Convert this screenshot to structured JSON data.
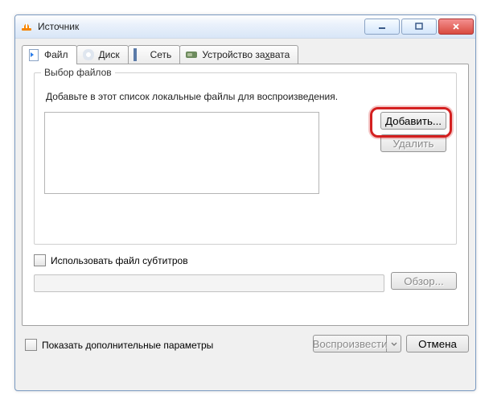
{
  "window": {
    "title": "Источник"
  },
  "tabs": {
    "file": {
      "label": "Файл"
    },
    "disc": {
      "label": "Диск"
    },
    "network": {
      "label": "Сеть"
    },
    "capture": {
      "label": "Устройство за",
      "label_ul": "х",
      "label_tail": "вата"
    }
  },
  "file_panel": {
    "group_title": "Выбор файлов",
    "hint": "Добавьте в этот список локальные файлы для воспроизведения.",
    "add_btn": "Добавить...",
    "remove_btn": "Удалить",
    "use_subs_label": "Использовать файл субтитров",
    "browse_btn": "Обзор..."
  },
  "advanced": {
    "show_more_label": "Показать дополнительные параметры"
  },
  "footer": {
    "play_btn": "Воспроизвести",
    "cancel_btn": "Отмена"
  }
}
